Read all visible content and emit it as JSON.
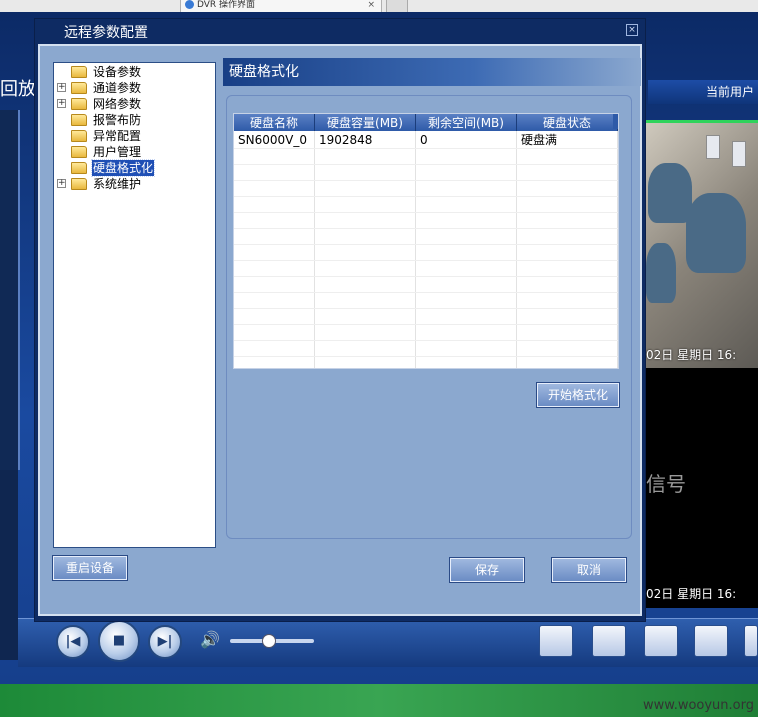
{
  "browser": {
    "tab_title": "DVR 操作界面",
    "tab_close": "×"
  },
  "app": {
    "left_tab_label": "回放",
    "right_header_label": "当前用户",
    "video1_osd": "02日 星期日 16:",
    "video2_no_signal": "信号",
    "video2_osd": "02日 星期日 16:"
  },
  "dialog": {
    "title": "远程参数配置",
    "close_glyph": "×",
    "tree": [
      {
        "label": "设备参数",
        "expandable": false,
        "selected": false
      },
      {
        "label": "通道参数",
        "expandable": true,
        "selected": false
      },
      {
        "label": "网络参数",
        "expandable": true,
        "selected": false
      },
      {
        "label": "报警布防",
        "expandable": false,
        "selected": false
      },
      {
        "label": "异常配置",
        "expandable": false,
        "selected": false
      },
      {
        "label": "用户管理",
        "expandable": false,
        "selected": false
      },
      {
        "label": "硬盘格式化",
        "expandable": false,
        "selected": true
      },
      {
        "label": "系统维护",
        "expandable": true,
        "selected": false
      }
    ],
    "panel_title": "硬盘格式化",
    "table": {
      "columns": [
        "硬盘名称",
        "硬盘容量(MB)",
        "剩余空间(MB)",
        "硬盘状态"
      ],
      "rows": [
        [
          "SN6000V_0",
          "1902848",
          "0",
          "硬盘满"
        ]
      ],
      "empty_rows": 14
    },
    "buttons": {
      "format": "开始格式化",
      "restart": "重启设备",
      "save": "保存",
      "cancel": "取消"
    }
  },
  "controls": {
    "prev": "|◀",
    "stop": "■",
    "next": "▶|",
    "volume_level": 0.45
  },
  "footer": {
    "watermark": "www.wooyun.org"
  },
  "colors": {
    "dialog_bg": "#8ba8cf",
    "title_bar": "#0e2b63",
    "selected_item": "#1f4fb5",
    "highlight_green": "#2fd35b"
  }
}
